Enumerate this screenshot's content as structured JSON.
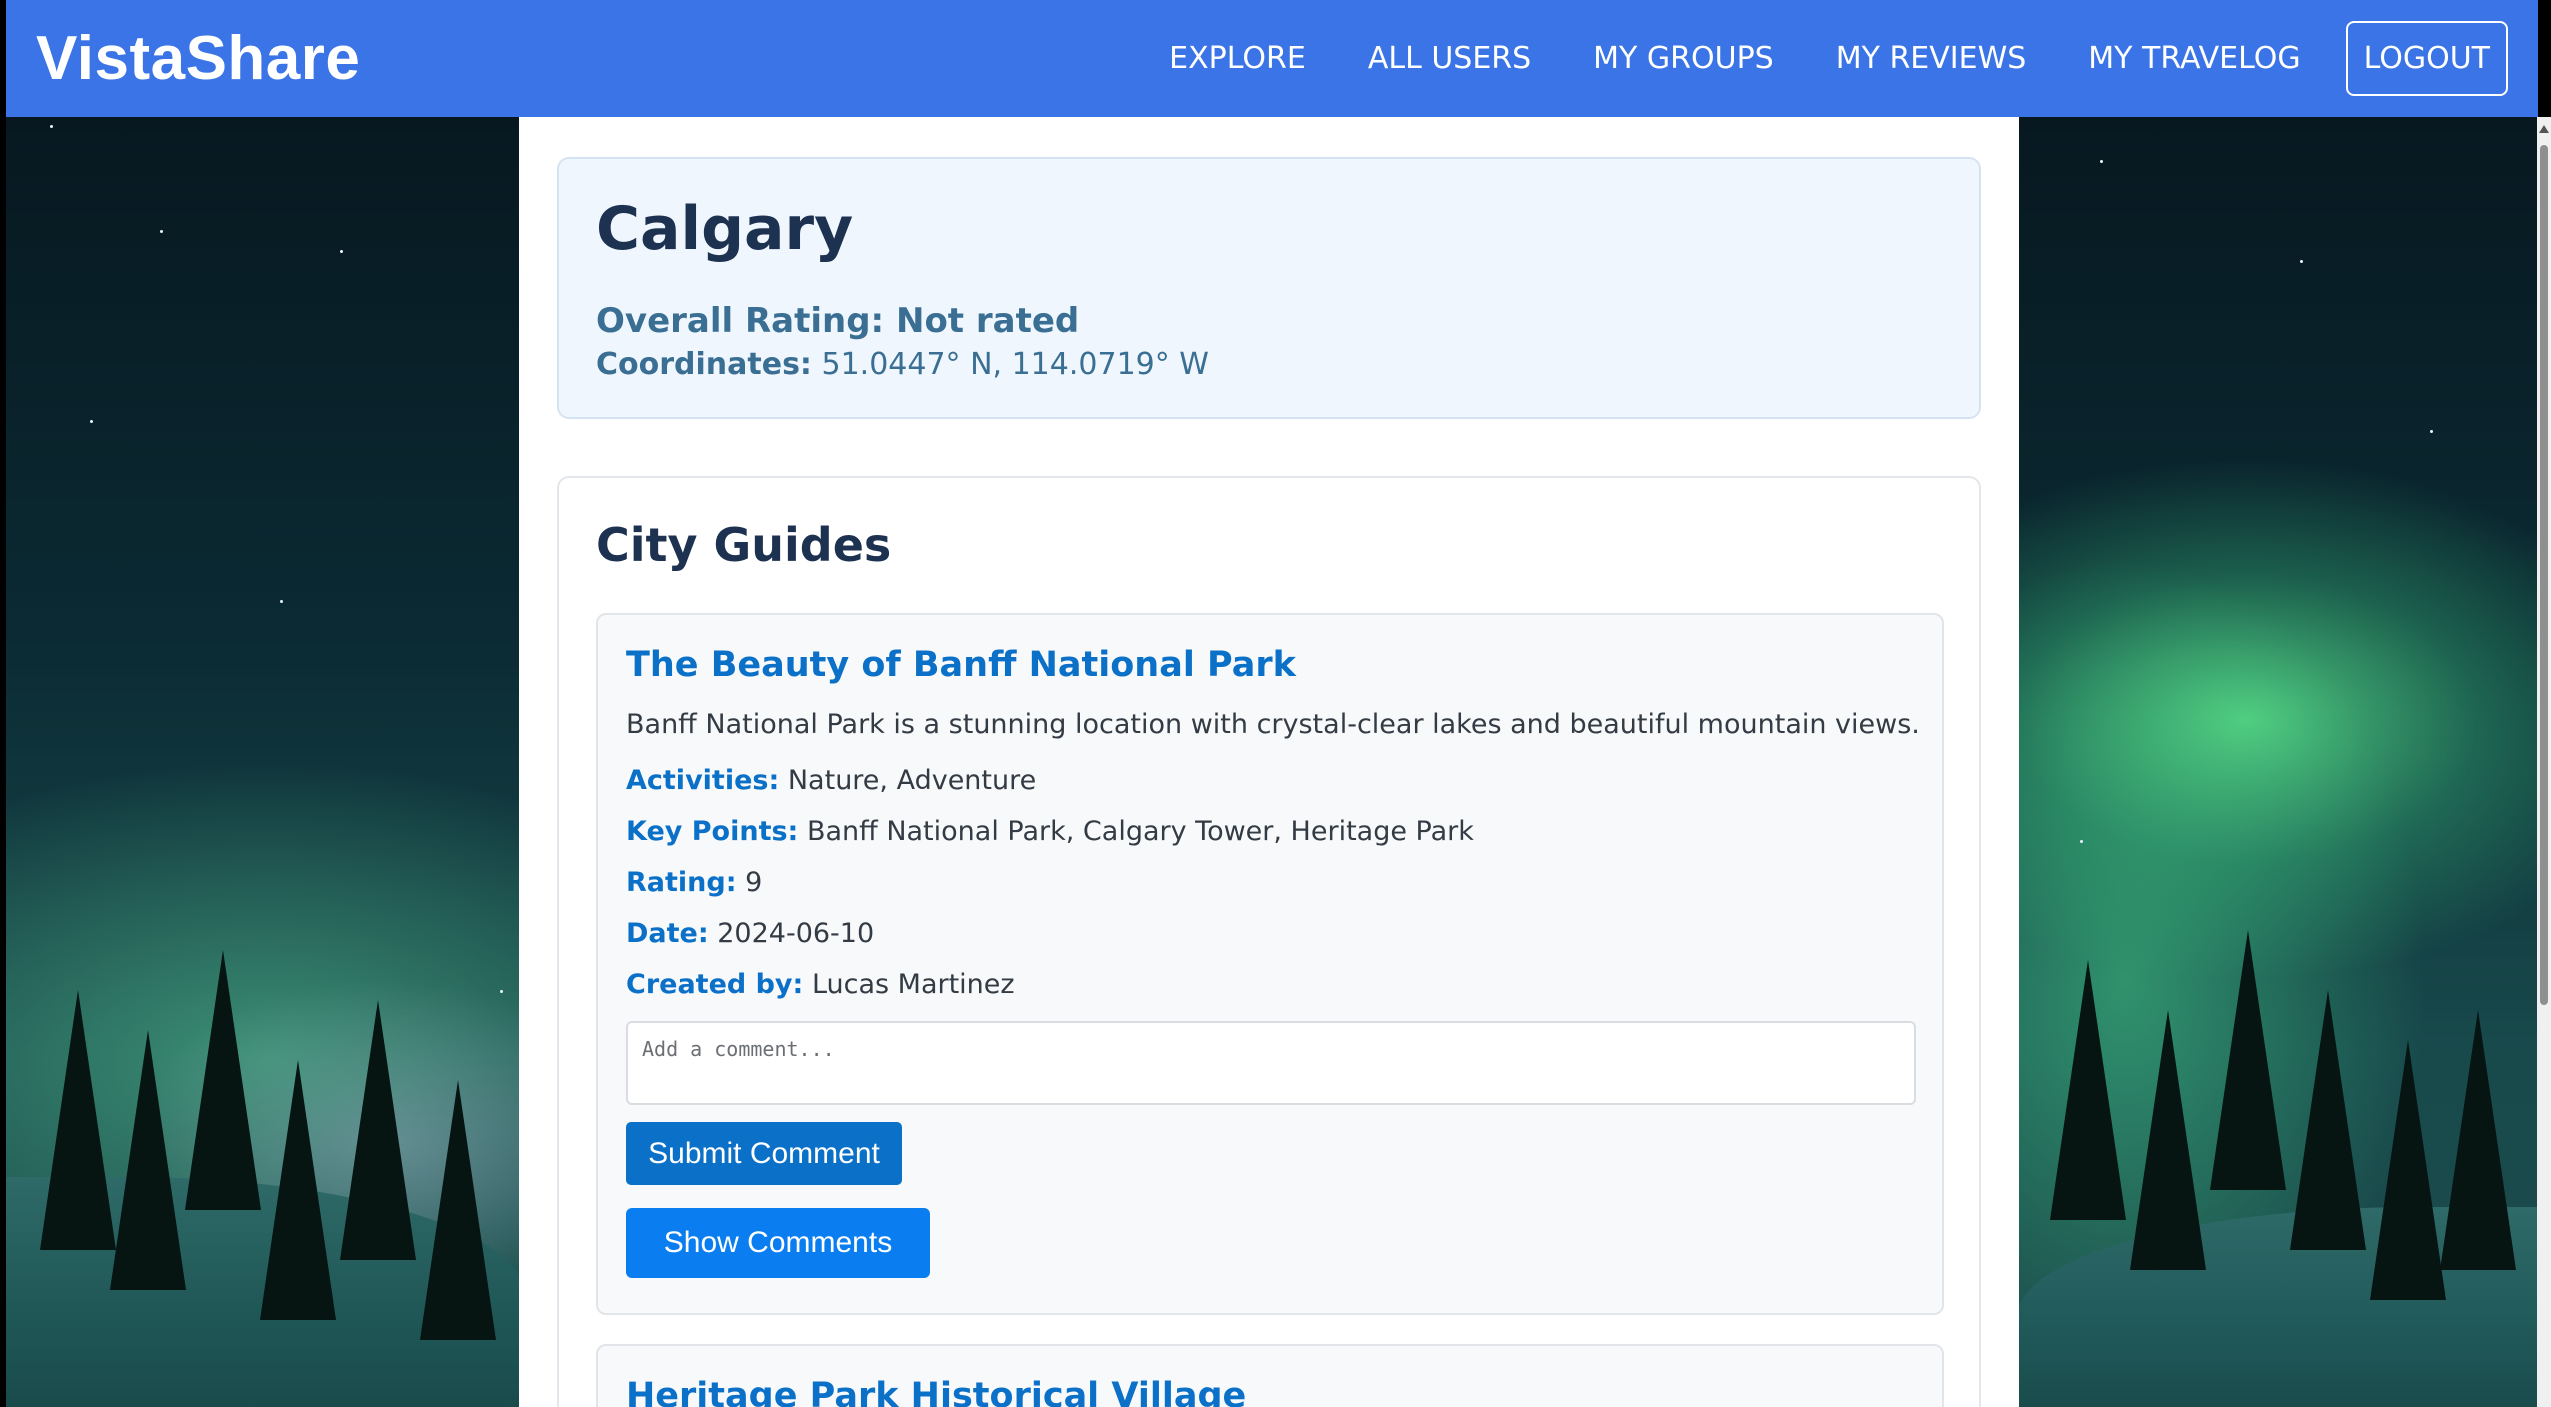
{
  "app": {
    "brand": "VistaShare"
  },
  "nav": {
    "items": [
      "EXPLORE",
      "ALL USERS",
      "MY GROUPS",
      "MY REVIEWS",
      "MY TRAVELOG"
    ],
    "logout": "LOGOUT"
  },
  "city": {
    "name": "Calgary",
    "rating_text": "Overall Rating: Not rated",
    "coordinates_label": "Coordinates:",
    "coordinates_value": "51.0447° N, 114.0719° W"
  },
  "guides": {
    "heading": "City Guides",
    "items": [
      {
        "title": "The Beauty of Banff National Park",
        "description": "Banff National Park is a stunning location with crystal-clear lakes and beautiful mountain views.",
        "activities_label": "Activities:",
        "activities": "Nature, Adventure",
        "key_points_label": "Key Points:",
        "key_points": "Banff National Park, Calgary Tower, Heritage Park",
        "rating_label": "Rating:",
        "rating": "9",
        "date_label": "Date:",
        "date": "2024-06-10",
        "created_by_label": "Created by:",
        "created_by": "Lucas Martinez",
        "comment_placeholder": "Add a comment...",
        "submit_label": "Submit Comment",
        "show_comments_label": "Show Comments"
      },
      {
        "title": "Heritage Park Historical Village"
      }
    ]
  },
  "colors": {
    "navbar": "#3b74e6",
    "link_blue": "#0a70c8",
    "heading_dark": "#1d3150",
    "muted_blue": "#3a6f93"
  }
}
